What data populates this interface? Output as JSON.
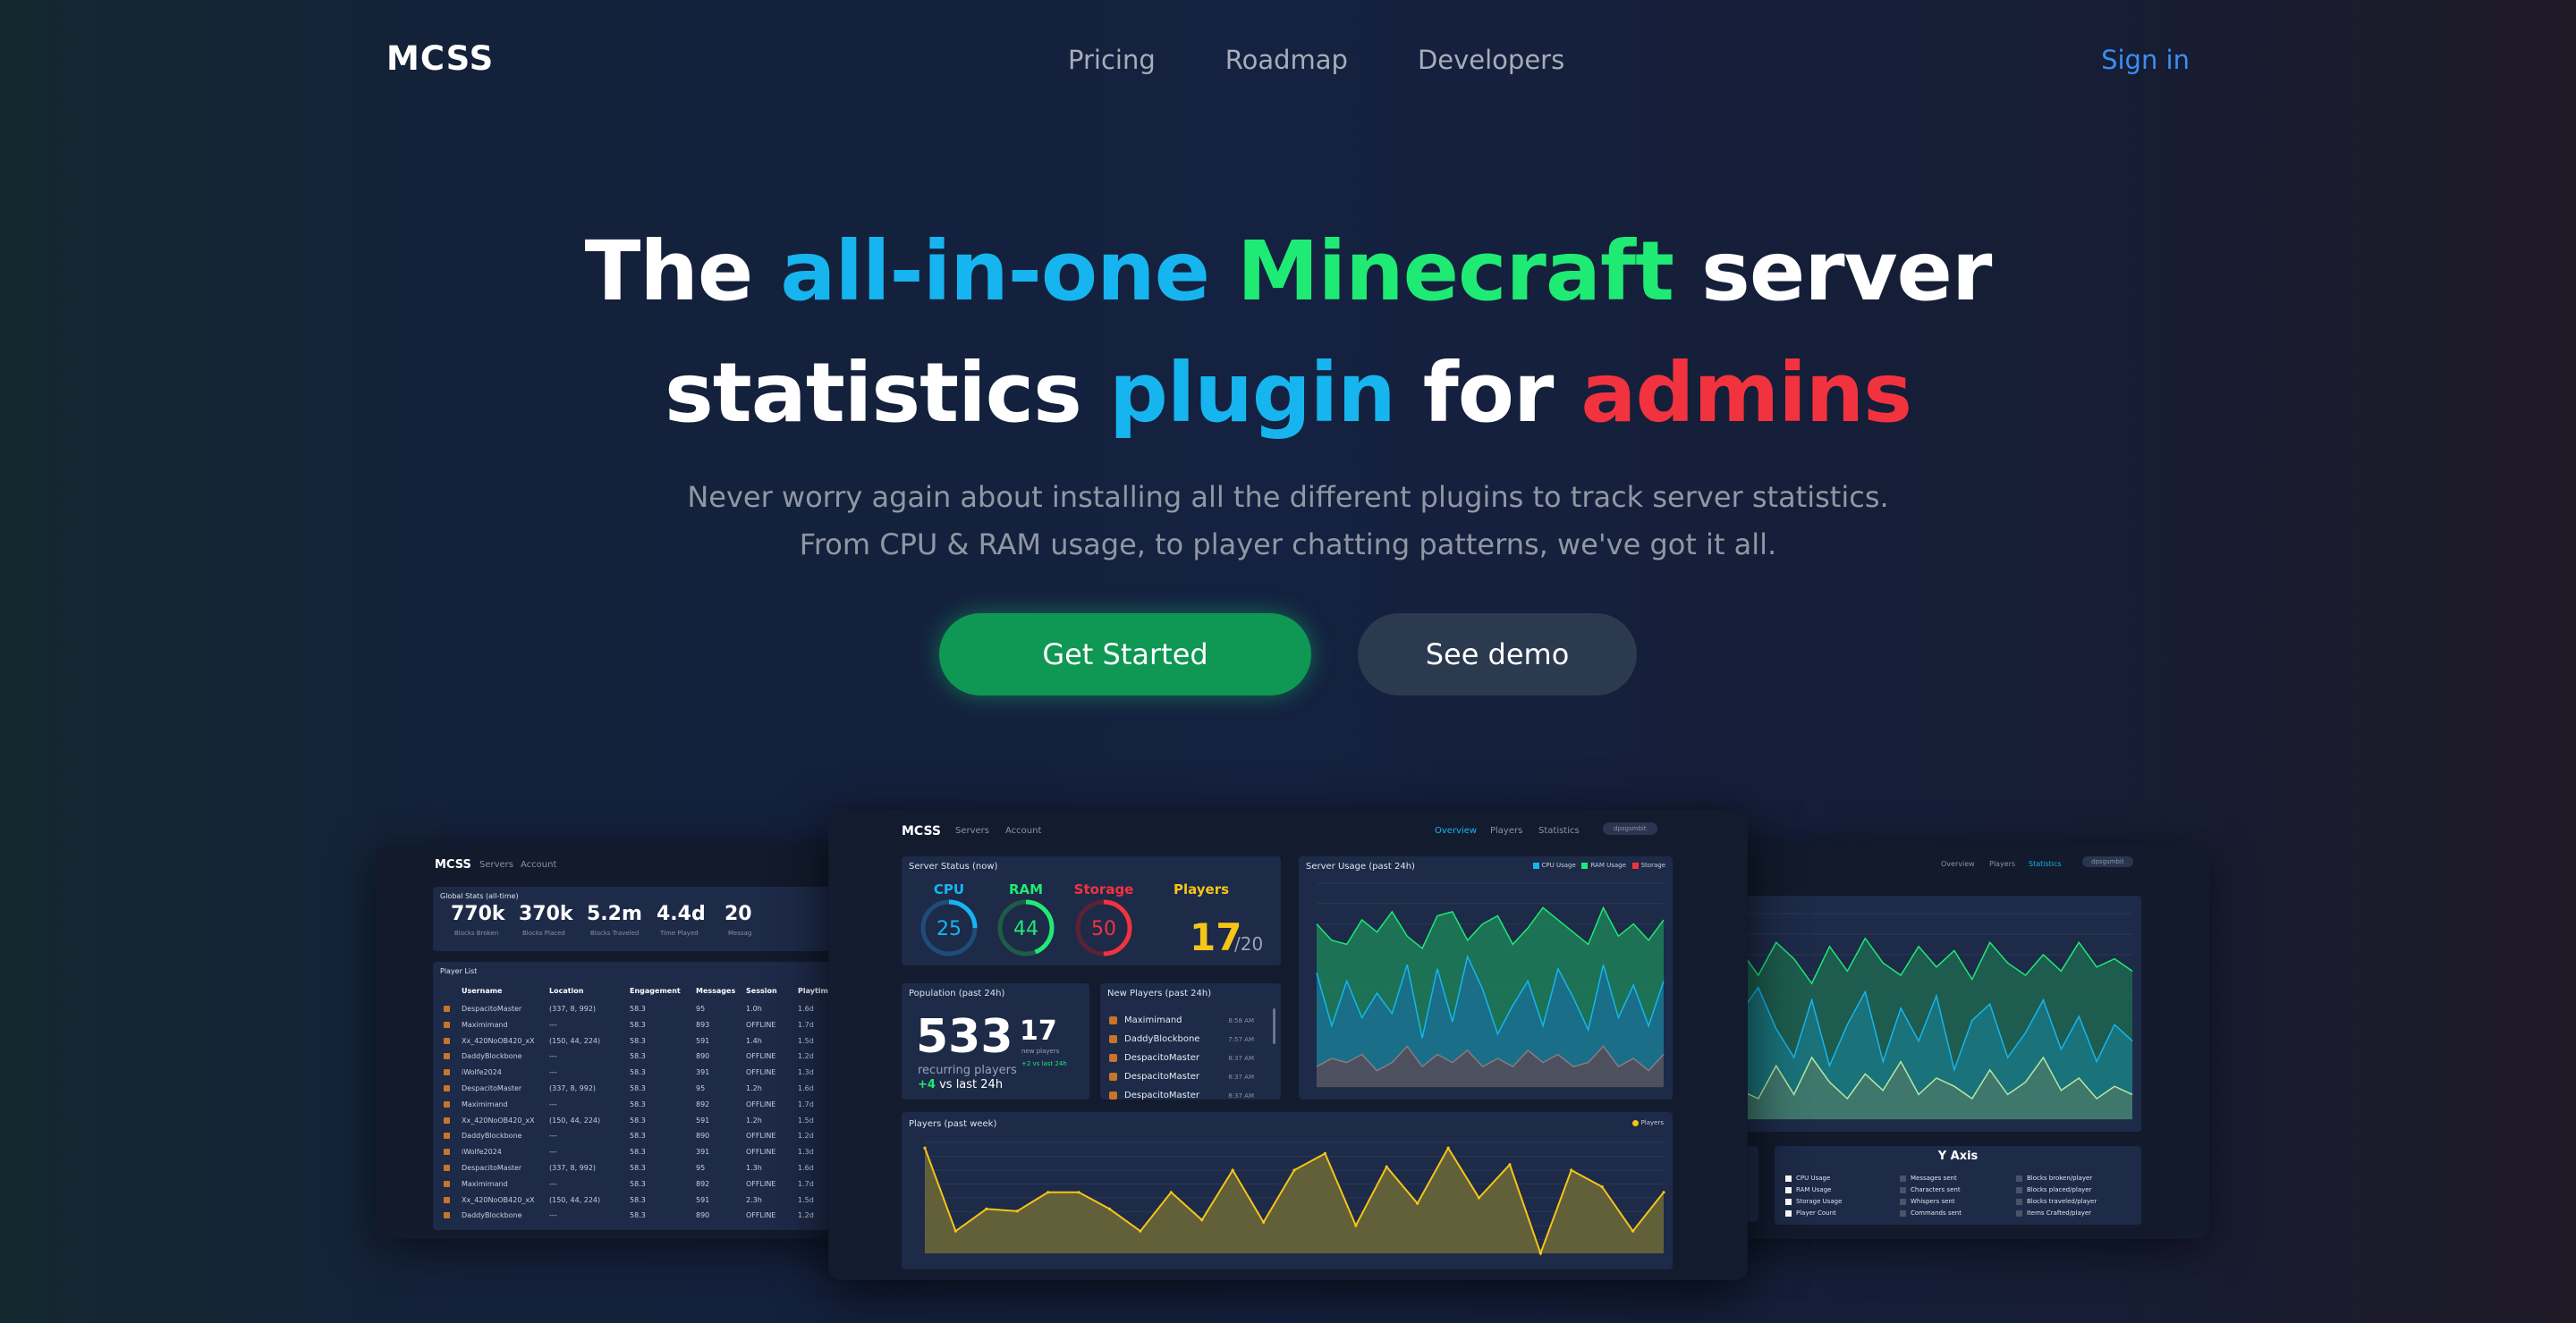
{
  "nav": {
    "logo": "MCSS",
    "links": [
      "Pricing",
      "Roadmap",
      "Developers"
    ],
    "signin": "Sign in"
  },
  "hero": {
    "line1": [
      "The ",
      "all-in-one",
      " ",
      "Minecraft",
      " server"
    ],
    "line2": [
      "statistics ",
      "plugin",
      " for ",
      "admins"
    ],
    "subtitle1": "Never worry again about installing all the different plugins to track server statistics.",
    "subtitle2": "From CPU & RAM usage, to player chatting patterns, we've got it all.",
    "cta_primary": "Get Started",
    "cta_secondary": "See demo"
  },
  "colors": {
    "blue": "#17b5ef",
    "green": "#1fea74",
    "red": "#f2333f",
    "primary_button": "#0f9754",
    "secondary_button": "#2c3a4f",
    "signin": "#3b8ef5"
  },
  "demo_center": {
    "logo": "MCSS",
    "nav": [
      "Servers",
      "Account"
    ],
    "tabs": [
      "Overview",
      "Players",
      "Statistics"
    ],
    "server_select": "dpsgsmbit",
    "server_status": {
      "title": "Server Status (now)",
      "cpu_label": "CPU",
      "cpu": "25",
      "cpu_pct": 25,
      "ram_label": "RAM",
      "ram": "44",
      "ram_pct": 44,
      "storage_label": "Storage",
      "storage": "50",
      "storage_pct": 50,
      "players_label": "Players",
      "players": "17",
      "players_max": "/20"
    },
    "population": {
      "title": "Population (past 24h)",
      "recurring": "533",
      "recurring_label": "recurring players",
      "recurring_delta": "+4",
      "recurring_delta_label": "vs last 24h",
      "new": "17",
      "new_label": "new players",
      "new_delta": "+2 vs last 24h"
    },
    "new_players": {
      "title": "New Players (past 24h)",
      "rows": [
        {
          "name": "Maximimand",
          "time": "8:58 AM"
        },
        {
          "name": "DaddyBlockbone",
          "time": "7:57 AM"
        },
        {
          "name": "DespacitoMaster",
          "time": "8:37 AM"
        },
        {
          "name": "DespacitoMaster",
          "time": "8:37 AM"
        },
        {
          "name": "DespacitoMaster",
          "time": "8:37 AM"
        }
      ]
    },
    "usage": {
      "title": "Server Usage (past 24h)",
      "legend": [
        "CPU Usage",
        "RAM Usage",
        "Storage"
      ]
    },
    "players_week": {
      "title": "Players (past week)",
      "legend": "Players"
    }
  },
  "demo_left": {
    "logo": "MCSS",
    "nav": [
      "Servers",
      "Account"
    ],
    "global_title": "Global Stats (all-time)",
    "stats": [
      {
        "value": "770k",
        "label": "Blocks Broken"
      },
      {
        "value": "370k",
        "label": "Blocks Placed"
      },
      {
        "value": "5.2m",
        "label": "Blocks Traveled"
      },
      {
        "value": "4.4d",
        "label": "Time Played"
      },
      {
        "value": "20",
        "label": "Messag"
      }
    ],
    "player_list_title": "Player List",
    "columns": [
      "Username",
      "Location",
      "Engagement",
      "Messages",
      "Session",
      "Playtim"
    ],
    "rows": [
      [
        "DespacitoMaster",
        "(337, 8, 992)",
        "58.3",
        "95",
        "1.0h",
        "1.6d"
      ],
      [
        "Maximimand",
        "---",
        "58.3",
        "893",
        "OFFLINE",
        "1.7d"
      ],
      [
        "Xx_420NoOB420_xX",
        "(150, 44, 224)",
        "58.3",
        "591",
        "1.4h",
        "1.5d"
      ],
      [
        "DaddyBlockbone",
        "---",
        "58.3",
        "890",
        "OFFLINE",
        "1.2d"
      ],
      [
        "iWolfe2024",
        "---",
        "58.3",
        "391",
        "OFFLINE",
        "1.3d"
      ],
      [
        "DespacitoMaster",
        "(337, 8, 992)",
        "58.3",
        "95",
        "1.2h",
        "1.6d"
      ],
      [
        "Maximimand",
        "---",
        "58.3",
        "892",
        "OFFLINE",
        "1.7d"
      ],
      [
        "Xx_420NoOB420_xX",
        "(150, 44, 224)",
        "58.3",
        "591",
        "1.2h",
        "1.5d"
      ],
      [
        "DaddyBlockbone",
        "---",
        "58.3",
        "890",
        "OFFLINE",
        "1.2d"
      ],
      [
        "iWolfe2024",
        "---",
        "58.3",
        "391",
        "OFFLINE",
        "1.3d"
      ],
      [
        "DespacitoMaster",
        "(337, 8, 992)",
        "58.3",
        "95",
        "1.3h",
        "1.6d"
      ],
      [
        "Maximimand",
        "---",
        "58.3",
        "892",
        "OFFLINE",
        "1.7d"
      ],
      [
        "Xx_420NoOB420_xX",
        "(150, 44, 224)",
        "58.3",
        "591",
        "2.3h",
        "1.5d"
      ],
      [
        "DaddyBlockbone",
        "---",
        "58.3",
        "890",
        "OFFLINE",
        "1.2d"
      ]
    ]
  },
  "demo_right": {
    "tabs": [
      "Overview",
      "Players",
      "Statistics"
    ],
    "server_select": "dpsgsmbit",
    "y_axis_title": "Y Axis",
    "options": [
      [
        "CPU Usage",
        "Messages sent",
        "Blocks broken/player"
      ],
      [
        "RAM Usage",
        "Characters sent",
        "Blocks placed/player"
      ],
      [
        "Storage Usage",
        "Whispers sent",
        "Blocks traveled/player"
      ],
      [
        "Player Count",
        "Commands sent",
        "Items Crafted/player"
      ]
    ]
  }
}
